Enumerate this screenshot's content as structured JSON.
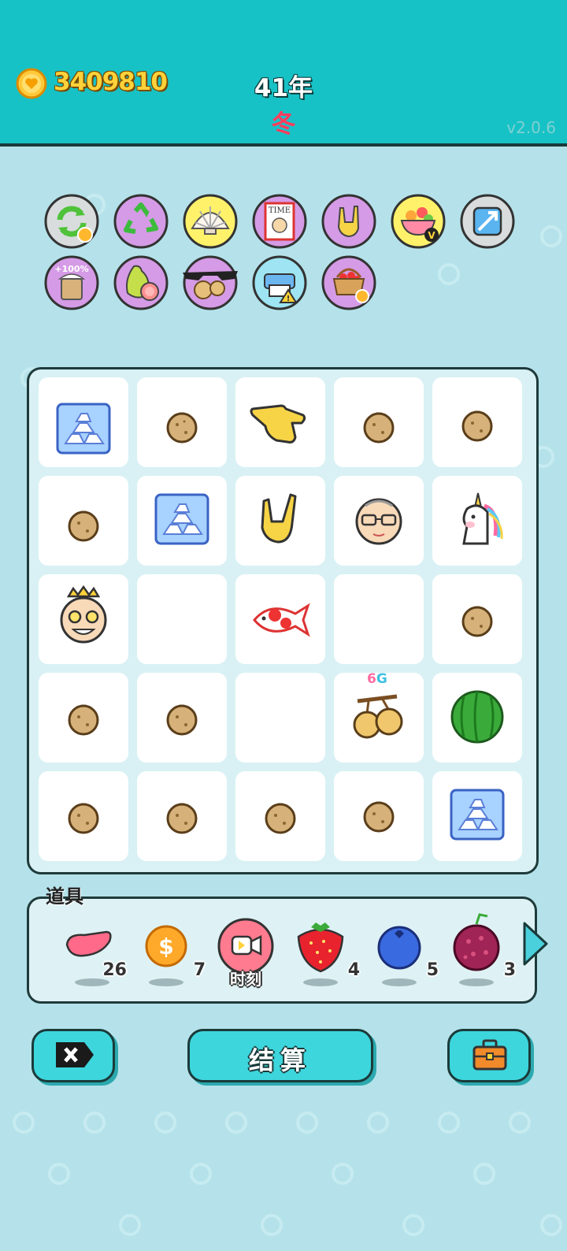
{
  "header": {
    "coins": "3409810",
    "year": "41年",
    "season": "冬",
    "version": "v2.0.6",
    "coin_icon": "heart-coin-icon"
  },
  "colors": {
    "header_bg": "#17c2c6",
    "page_bg": "#b5e2ea",
    "coin_text": "#ffd23a",
    "season_text": "#ff3d5d",
    "button_bg": "#3dd6dc",
    "buff_purple": "#d59be6",
    "buff_yellow": "#fff26a",
    "buff_grey": "#d8dcdc",
    "buff_blue": "#9ee4f2"
  },
  "buffs": [
    {
      "icon": "refresh-arrows-icon"
    },
    {
      "icon": "recycle-icon"
    },
    {
      "icon": "shell-icon"
    },
    {
      "icon": "time-magazine-icon",
      "text": "TIME"
    },
    {
      "icon": "rock-hand-icon"
    },
    {
      "icon": "fruit-bowl-icon"
    },
    {
      "icon": "upgrade-arrow-icon"
    },
    {
      "icon": "plus100-jar-icon",
      "text": "+100%"
    },
    {
      "icon": "pomelo-icon"
    },
    {
      "icon": "longan-sunglasses-icon"
    },
    {
      "icon": "printer-warning-icon"
    },
    {
      "icon": "fruit-basket-icon"
    }
  ],
  "board": {
    "rows": [
      [
        "silver-bars-icon",
        "longan-icon",
        "pointing-hand-icon",
        "longan-icon",
        "longan-icon"
      ],
      [
        "longan-icon",
        "silver-bars-icon",
        "rock-hand-icon",
        "grandpa-icon",
        "unicorn-icon"
      ],
      [
        "king-grandpa-icon",
        "",
        "koi-fish-icon",
        "",
        "longan-icon"
      ],
      [
        "longan-icon",
        "longan-icon",
        "",
        "longan-pair-icon",
        "watermelon-icon"
      ],
      [
        "longan-icon",
        "longan-icon",
        "longan-icon",
        "longan-icon",
        "silver-bars-icon"
      ]
    ],
    "badge_prefix": "6",
    "badge_suffix": "G"
  },
  "props": {
    "label": "道具",
    "items": [
      {
        "icon": "liver-icon",
        "count": "26"
      },
      {
        "icon": "dollar-coin-icon",
        "count": "7"
      },
      {
        "icon": "video-icon",
        "label": "时刻"
      },
      {
        "icon": "strawberry-icon",
        "count": "4"
      },
      {
        "icon": "blueberry-icon",
        "count": "5"
      },
      {
        "icon": "bayberry-icon",
        "count": "3"
      }
    ]
  },
  "buttons": {
    "close_icon": "close-tag-icon",
    "settle_label": "结算",
    "bag_icon": "briefcase-icon"
  }
}
